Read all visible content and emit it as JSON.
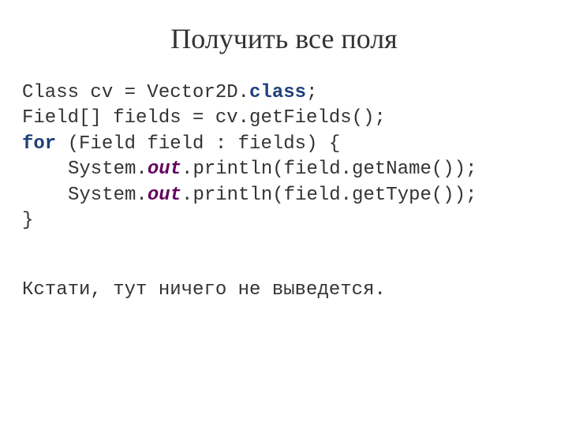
{
  "title": "Получить все поля",
  "code": {
    "line1_pre": "Class cv = Vector2D.",
    "line1_kw": "class",
    "line1_post": ";",
    "line2": "Field[] fields = cv.getFields();",
    "line3_kw": "for",
    "line3_post": " (Field field : fields) {",
    "line45_pre": "System.",
    "line45_kw": "out",
    "line4_post": ".println(field.getName());",
    "line5_post": ".println(field.getType());",
    "line6": "}"
  },
  "note": "Кстати, тут ничего не выведется."
}
